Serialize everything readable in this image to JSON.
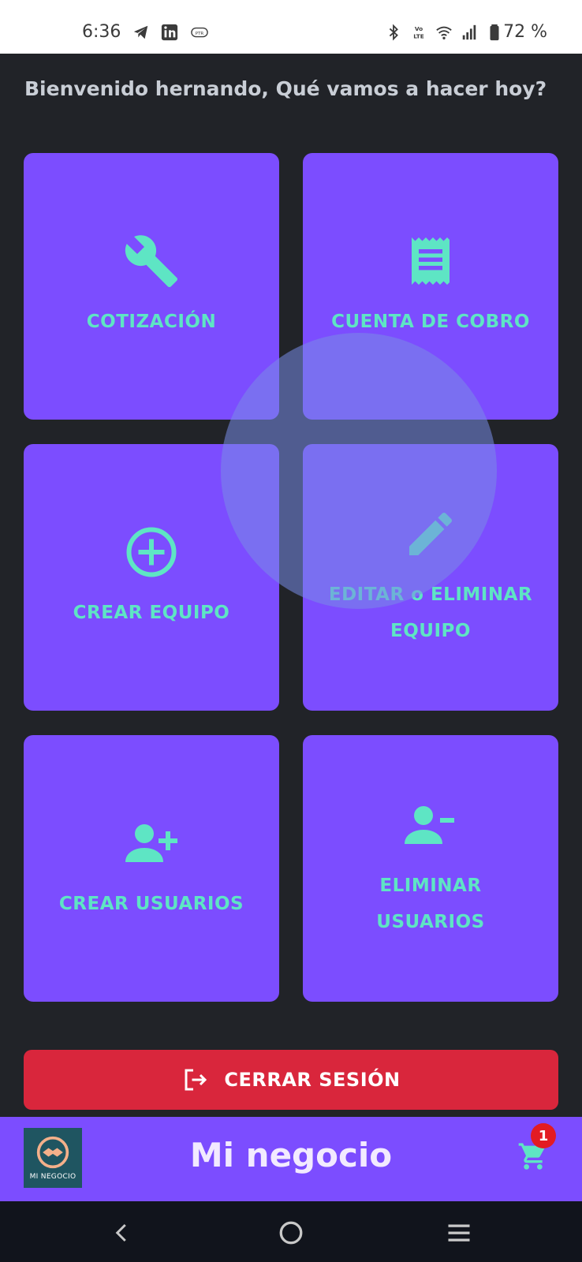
{
  "status_bar": {
    "time": "6:36",
    "battery": "72 %",
    "left_icons": [
      "telegram-icon",
      "linkedin-icon",
      "pointer-app-icon"
    ],
    "right_icons": [
      "bluetooth-icon",
      "volte-icon",
      "wifi-icon",
      "signal-icon",
      "battery-icon"
    ]
  },
  "greeting": "Bienvenido hernando, Qué vamos a hacer hoy?",
  "tiles": [
    {
      "label": "COTIZACIÓN",
      "icon": "wrench-icon"
    },
    {
      "label": "CUENTA DE COBRO",
      "icon": "receipt-icon"
    },
    {
      "label": "CREAR EQUIPO",
      "icon": "add-circle-icon"
    },
    {
      "label": "EDITAR o ELIMINAR EQUIPO",
      "icon": "pencil-icon"
    },
    {
      "label": "CREAR USUARIOS",
      "icon": "person-add-icon"
    },
    {
      "label": "ELIMINAR USUARIOS",
      "icon": "person-remove-icon"
    }
  ],
  "logout": {
    "label": "CERRAR SESIÓN",
    "icon": "logout-icon"
  },
  "app_bar": {
    "title": "Mi negocio",
    "logo_text": "MI NEGOCIO",
    "cart_badge": "1"
  },
  "colors": {
    "background": "#212328",
    "tile": "#7c4dff",
    "accent": "#5ee5c4",
    "logout": "#d9263c",
    "badge": "#e31b23"
  }
}
